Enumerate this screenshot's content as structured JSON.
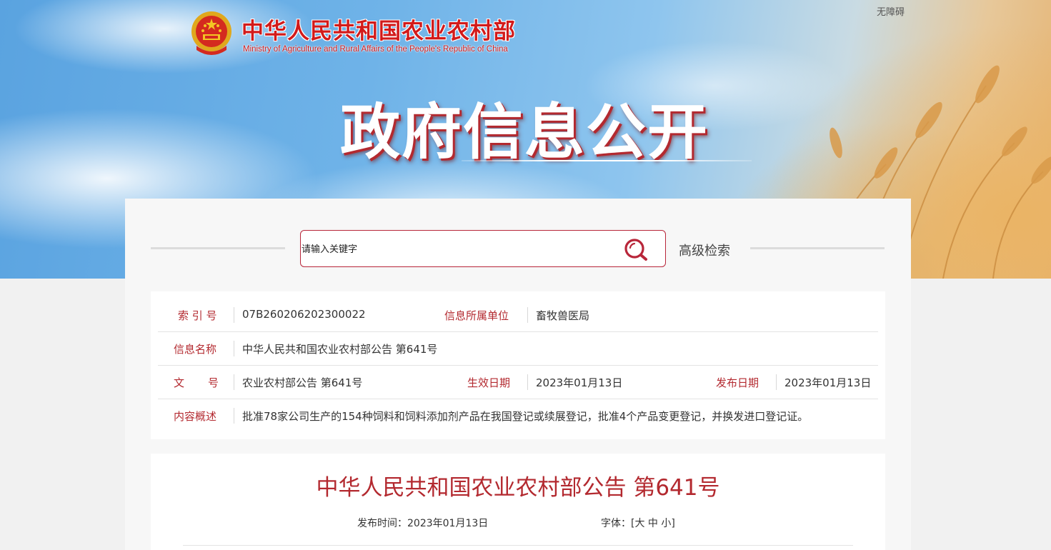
{
  "header": {
    "site_title": "中华人民共和国农业农村部",
    "site_subtitle": "Ministry of Agriculture and Rural Affairs of the People's Republic of China",
    "accessibility_link": "无障碍",
    "section_title": "政府信息公开",
    "emblem_icon": "national-emblem-icon"
  },
  "search": {
    "placeholder": "请输入关键字",
    "value": "",
    "button_icon": "search-icon",
    "advanced_label": "高级检索"
  },
  "info": {
    "index_label": "索 引 号",
    "index_value": "07B260206202300022",
    "unit_label": "信息所属单位",
    "unit_value": "畜牧兽医局",
    "name_label": "信息名称",
    "name_value": "中华人民共和国农业农村部公告 第641号",
    "doc_label_a": "文",
    "doc_label_b": "号",
    "doc_value": "农业农村部公告 第641号",
    "effective_label": "生效日期",
    "effective_value": "2023年01月13日",
    "publish_label": "发布日期",
    "publish_value": "2023年01月13日",
    "summary_label": "内容概述",
    "summary_value": "批准78家公司生产的154种饲料和饲料添加剂产品在我国登记或续展登记，批准4个产品变更登记，并换发进口登记证。"
  },
  "article": {
    "title": "中华人民共和国农业农村部公告 第641号",
    "publish_time_label": "发布时间：",
    "publish_time_value": "2023年01月13日",
    "font_label": "字体：",
    "font_open": "[",
    "font_large": "大",
    "font_medium": "中",
    "font_small": "小",
    "font_close": "]"
  },
  "colors": {
    "brand_red": "#d21a1a",
    "label_red": "#b3292f",
    "search_border": "#b8263a"
  }
}
